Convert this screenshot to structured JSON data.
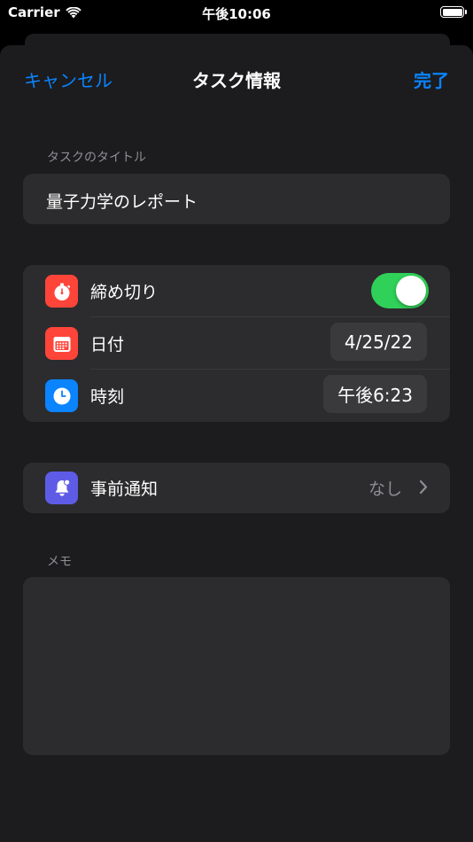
{
  "status_bar": {
    "carrier": "Carrier",
    "time": "午後10:06"
  },
  "nav": {
    "cancel_label": "キャンセル",
    "title": "タスク情報",
    "done_label": "完了"
  },
  "title_section": {
    "label": "タスクのタイトル",
    "value": "量子力学のレポート"
  },
  "deadline_section": {
    "deadline": {
      "label": "締め切り",
      "enabled": true,
      "icon": "stopwatch-icon",
      "color": "#ff453a"
    },
    "date": {
      "label": "日付",
      "value": "4/25/22",
      "icon": "calendar-icon",
      "color": "#ff453a"
    },
    "time": {
      "label": "時刻",
      "value": "午後6:23",
      "icon": "clock-icon",
      "color": "#0a84ff"
    }
  },
  "notification_section": {
    "label": "事前通知",
    "value": "なし",
    "icon": "bell-badge-icon",
    "color": "#5e5ce6"
  },
  "memo_section": {
    "label": "メモ",
    "value": ""
  },
  "colors": {
    "accent": "#0a84ff",
    "toggle_on": "#30d158",
    "background": "#1c1c1e",
    "cell": "#2c2c2e"
  }
}
